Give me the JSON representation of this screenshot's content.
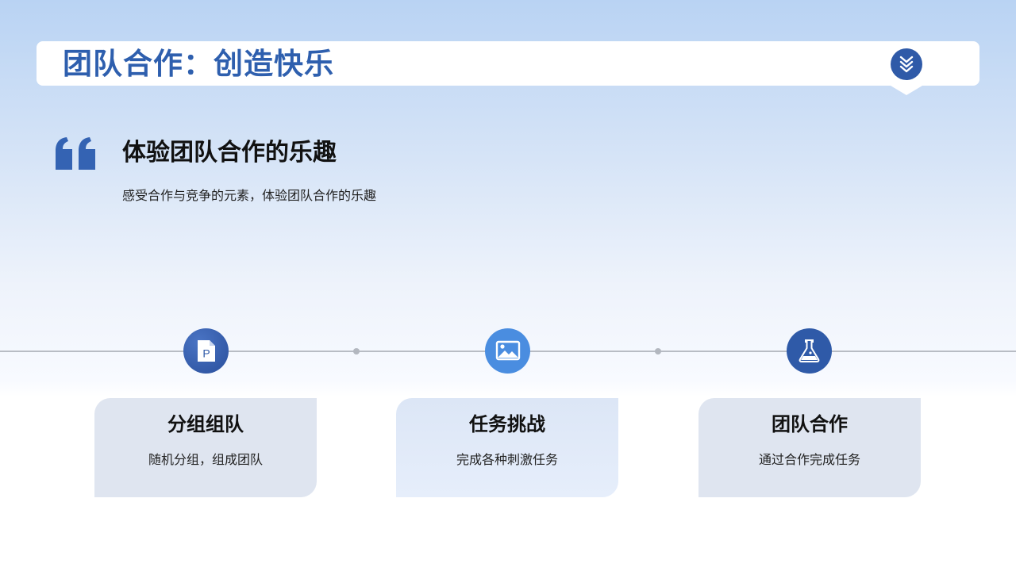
{
  "header": {
    "title": "团队合作：创造快乐",
    "badge_icon": "double-chevron-down-icon"
  },
  "section": {
    "heading": "体验团队合作的乐趣",
    "subtitle": "感受合作与竞争的元素，体验团队合作的乐趣",
    "quote_icon": "quote-icon"
  },
  "steps": [
    {
      "icon": "document-p-icon",
      "title": "分组组队",
      "desc": "随机分组，组成团队"
    },
    {
      "icon": "image-icon",
      "title": "任务挑战",
      "desc": "完成各种刺激任务"
    },
    {
      "icon": "flask-icon",
      "title": "团队合作",
      "desc": "通过合作完成任务"
    }
  ],
  "colors": {
    "accent": "#2e5fae",
    "badge": "#2f5aa8",
    "icon_blue_dark": "#2f5aa8",
    "icon_blue_light": "#4a8de0",
    "card_grey": "#dfe5f0",
    "card_blue": "#e1eaf8"
  }
}
